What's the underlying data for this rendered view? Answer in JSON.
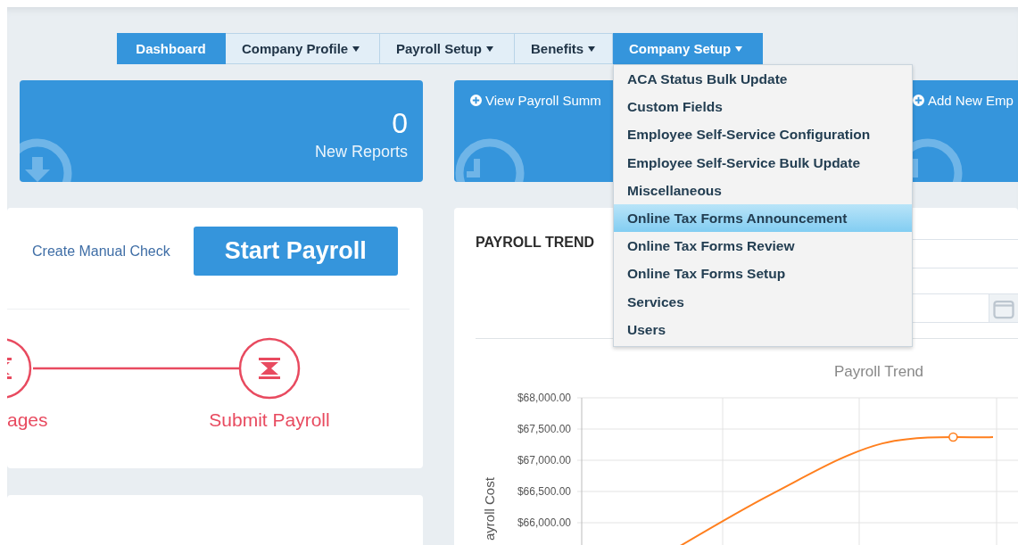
{
  "nav": {
    "tabs": [
      {
        "label": "Dashboard",
        "selected": true,
        "has_menu": false,
        "open": false
      },
      {
        "label": "Company Profile",
        "selected": false,
        "has_menu": true,
        "open": false
      },
      {
        "label": "Payroll Setup",
        "selected": false,
        "has_menu": true,
        "open": false
      },
      {
        "label": "Benefits",
        "selected": false,
        "has_menu": true,
        "open": false
      },
      {
        "label": "Company Setup",
        "selected": true,
        "has_menu": true,
        "open": true,
        "menu": [
          {
            "label": "ACA Status Bulk Update",
            "selected": false
          },
          {
            "label": "Custom Fields",
            "selected": false
          },
          {
            "label": "Employee Self-Service Configuration",
            "selected": false
          },
          {
            "label": "Employee Self-Service Bulk Update",
            "selected": false
          },
          {
            "label": "Miscellaneous",
            "selected": false
          },
          {
            "label": "Online Tax Forms Announcement",
            "selected": true
          },
          {
            "label": "Online Tax Forms Review",
            "selected": false
          },
          {
            "label": "Online Tax Forms Setup",
            "selected": false
          },
          {
            "label": "Services",
            "selected": false
          },
          {
            "label": "Users",
            "selected": false
          }
        ]
      }
    ]
  },
  "cards": [
    {
      "kind": "stat",
      "count": "0",
      "label": "New Reports"
    },
    {
      "kind": "link",
      "label": "View Payroll Summ"
    },
    {
      "kind": "link",
      "label": "Add New Emp"
    }
  ],
  "payroll": {
    "link": "Create Manual Check",
    "button": "Start Payroll",
    "steps": [
      {
        "label": "ages"
      },
      {
        "label": "Submit Payroll"
      }
    ]
  },
  "trends": {
    "title": "PAYROLL TREND",
    "filters": [
      {
        "kind": "select"
      },
      {
        "kind": "date"
      }
    ],
    "chart_data": {
      "type": "line",
      "title": "Payroll Trend",
      "ylabel": "ayroll Cost",
      "ylim": [
        65300,
        68000
      ],
      "grid": true,
      "yticks": [
        {
          "value": 68000,
          "label": "$68,000.00"
        },
        {
          "value": 67500,
          "label": "$67,500.00"
        },
        {
          "value": 67000,
          "label": "$67,000.00"
        },
        {
          "value": 66500,
          "label": "$66,500.00"
        },
        {
          "value": 66000,
          "label": "$66,000.00"
        }
      ],
      "series": [
        {
          "color": "#ff7f1e",
          "values": [
            65450,
            66460,
            67270,
            67370
          ]
        }
      ]
    }
  }
}
